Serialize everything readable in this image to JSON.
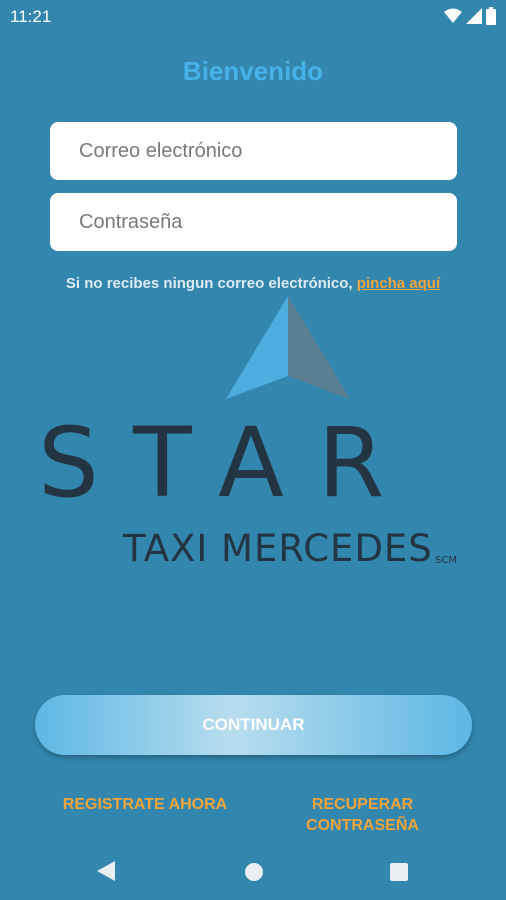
{
  "status_bar": {
    "time": "11:21"
  },
  "title": "Bienvenido",
  "email_input": {
    "placeholder": "Correo electrónico",
    "value": ""
  },
  "password_input": {
    "placeholder": "Contraseña",
    "value": ""
  },
  "hint": {
    "text": "Si no recibes ningun correo electrónico, ",
    "link": "pincha aquí"
  },
  "logo": {
    "brand": "STAR",
    "subtitle": "TAXI MERCEDES",
    "suffix": "SCM"
  },
  "continue_label": "CONTINUAR",
  "register_label": "REGISTRATE AHORA",
  "recover_label": "RECUPERAR CONTRASEÑA",
  "colors": {
    "background": "#3386AE",
    "title": "#46B2E8",
    "link": "#F0A43A",
    "logo_text": "#233443"
  },
  "icons": [
    "wifi-icon",
    "signal-icon",
    "battery-icon",
    "nav-back-icon",
    "nav-home-icon",
    "nav-recent-icon"
  ]
}
